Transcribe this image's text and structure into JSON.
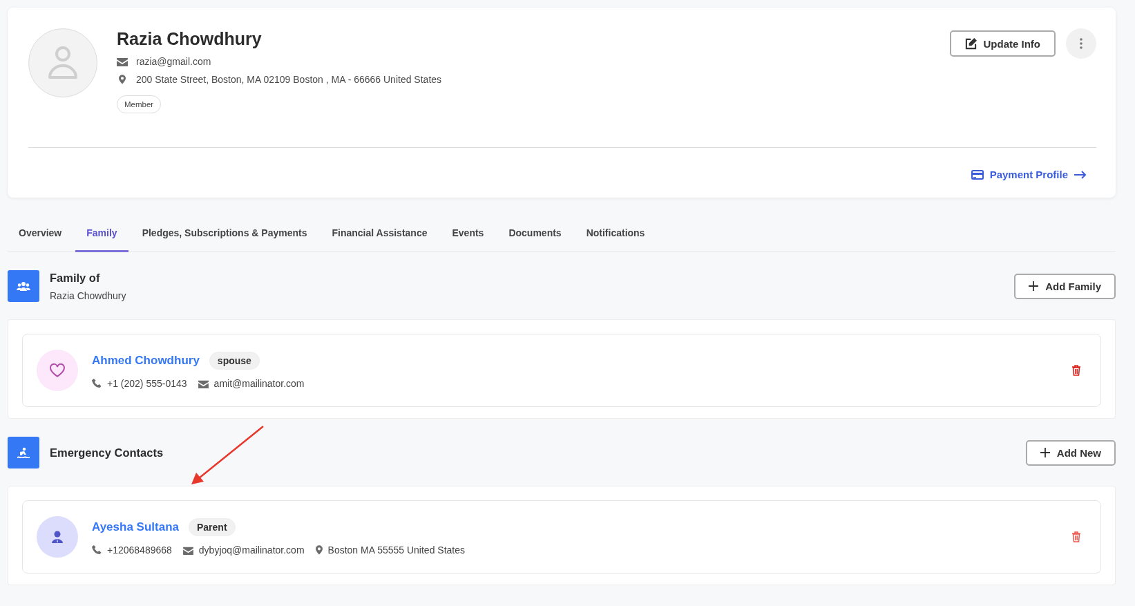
{
  "profile": {
    "name": "Razia Chowdhury",
    "email": "razia@gmail.com",
    "address": "200 State Street, Boston, MA 02109 Boston , MA - 66666 United States",
    "badge": "Member",
    "update_button": "Update Info",
    "payment_link": "Payment Profile"
  },
  "tabs": [
    {
      "label": "Overview",
      "selected": false
    },
    {
      "label": "Family",
      "selected": true
    },
    {
      "label": "Pledges, Subscriptions & Payments",
      "selected": false
    },
    {
      "label": "Financial Assistance",
      "selected": false
    },
    {
      "label": "Events",
      "selected": false
    },
    {
      "label": "Documents",
      "selected": false
    },
    {
      "label": "Notifications",
      "selected": false
    }
  ],
  "sections": [
    {
      "kind": "family",
      "title": "Family of",
      "subtitle": "Razia Chowdhury",
      "button": "Add Family",
      "contacts": [
        {
          "name": "Ahmed Chowdhury",
          "relation": "spouse",
          "phone": "+1 (202) 555-0143",
          "email": "amit@mailinator.com"
        }
      ]
    },
    {
      "kind": "emergency",
      "title": "Emergency Contacts",
      "button": "Add New",
      "contacts": [
        {
          "name": "Ayesha Sultana",
          "relation": "Parent",
          "phone": "+12068489668",
          "email": "dybyjoq@mailinator.com",
          "address": "Boston MA 55555 United States"
        }
      ]
    }
  ]
}
